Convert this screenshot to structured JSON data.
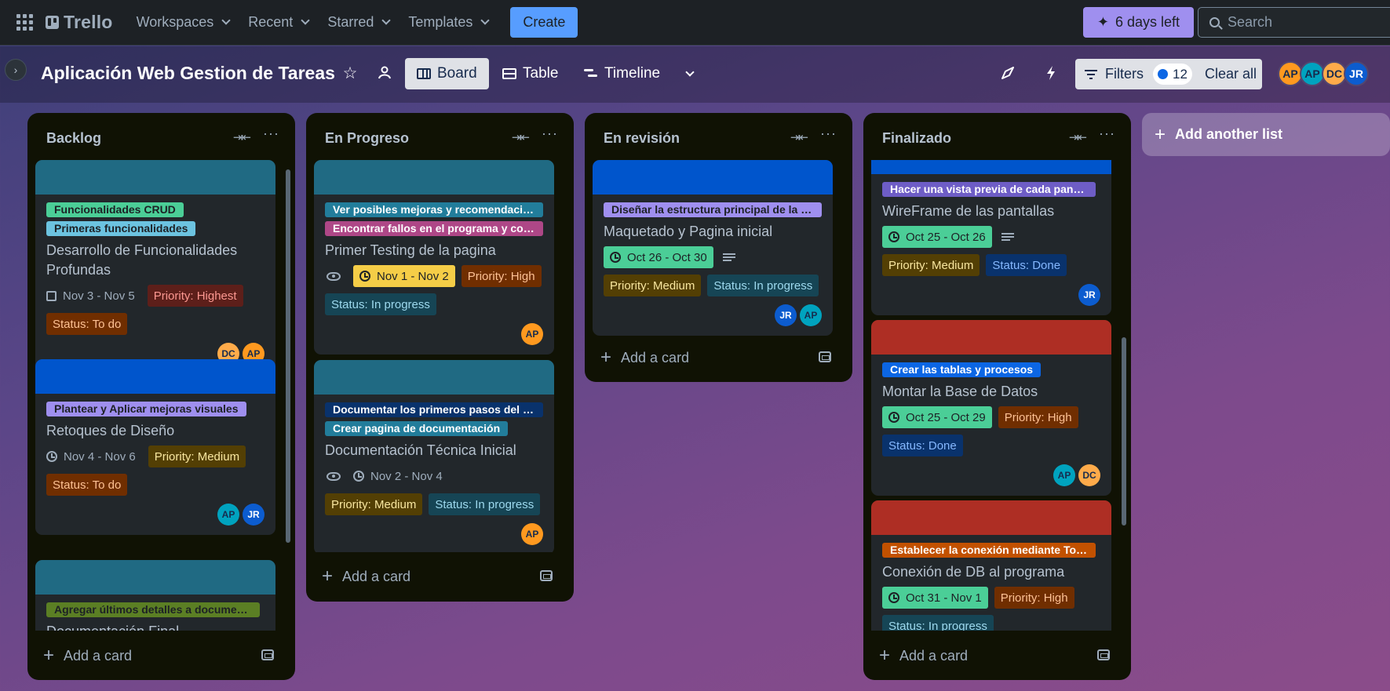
{
  "topbar": {
    "logo": "Trello",
    "nav": [
      {
        "label": "Workspaces"
      },
      {
        "label": "Recent"
      },
      {
        "label": "Starred"
      },
      {
        "label": "Templates"
      }
    ],
    "create_label": "Create",
    "trial_label": "6 days left",
    "search_placeholder": "Search",
    "colors": {
      "create": "#579dff",
      "trial": "#9f8fef"
    }
  },
  "board": {
    "title": "Aplicación Web Gestion de Tareas",
    "views": {
      "board": "Board",
      "table": "Table",
      "timeline": "Timeline"
    },
    "filters_label": "Filters",
    "filters_count": "12",
    "clear_all": "Clear all",
    "members": [
      "AP",
      "AP",
      "DC",
      "JR"
    ],
    "add_list": "Add another list",
    "add_card": "Add a card"
  },
  "lists": [
    {
      "title": "Backlog",
      "cards": [
        {
          "labels": [
            "Funcionalidades CRUD",
            "Primeras funcionalidades"
          ],
          "title": "Desarrollo de Funcionalidades Profundas",
          "date": "Nov 3 - Nov 5",
          "priority": "Priority: Highest",
          "status": "Status: To do",
          "members": [
            "DC",
            "AP"
          ]
        },
        {
          "labels": [
            "Plantear y Aplicar mejoras visuales"
          ],
          "title": "Retoques de Diseño",
          "date": "Nov 4 - Nov 6",
          "priority": "Priority: Medium",
          "status": "Status: To do",
          "members": [
            "AP",
            "JR"
          ]
        },
        {
          "labels": [
            "Agregar últimos detalles a documentación"
          ],
          "title": "Documentación Final"
        }
      ]
    },
    {
      "title": "En Progreso",
      "cards": [
        {
          "labels": [
            "Ver posibles mejoras y recomendaciones",
            "Encontrar fallos en el programa y corregirlos"
          ],
          "title": "Primer Testing de la pagina",
          "date": "Nov 1 - Nov 2",
          "priority": "Priority: High",
          "status": "Status: In progress",
          "members": [
            "AP"
          ]
        },
        {
          "labels": [
            "Documentar los primeros pasos del proyecto",
            "Crear pagina de documentación"
          ],
          "title": "Documentación Técnica Inicial",
          "date": "Nov 2 - Nov 4",
          "priority": "Priority: Medium",
          "status": "Status: In progress",
          "members": [
            "AP"
          ]
        }
      ]
    },
    {
      "title": "En revisión",
      "cards": [
        {
          "labels": [
            "Diseñar la estructura principal de la pagina"
          ],
          "title": "Maquetado y Pagina inicial",
          "date": "Oct 26 - Oct 30",
          "priority": "Priority: Medium",
          "status": "Status: In progress",
          "members": [
            "JR",
            "AP"
          ]
        }
      ]
    },
    {
      "title": "Finalizado",
      "cards": [
        {
          "labels": [
            "Hacer una vista previa de cada pantalla"
          ],
          "title": "WireFrame de las pantallas",
          "date": "Oct 25 - Oct 26",
          "priority": "Priority: Medium",
          "status": "Status: Done",
          "members": [
            "JR"
          ]
        },
        {
          "labels": [
            "Crear las tablas y procesos"
          ],
          "title": "Montar la Base de Datos",
          "date": "Oct 25 - Oct 29",
          "priority": "Priority: High",
          "status": "Status: Done",
          "members": [
            "AP",
            "DC"
          ]
        },
        {
          "labels": [
            "Establecer la conexión mediante Tokens"
          ],
          "title": "Conexión de DB al programa",
          "date": "Oct 31 - Nov 1",
          "priority": "Priority: High",
          "status": "Status: In progress"
        }
      ]
    }
  ],
  "colors": {
    "cover_teal": "#206a83",
    "cover_blue": "#0055cc",
    "cover_red": "#ae2e24",
    "label_green": "#4bce97",
    "label_sky": "#6cc3e0",
    "label_purple": "#9f8fef",
    "label_teal": "#227d9b",
    "label_pink": "#ae4787",
    "label_navy": "#09326c",
    "label_lime": "#5b7f24",
    "label_orange": "#c25100",
    "label_blue": "#0c66e4",
    "label_deep_purple": "#6e5dc6"
  }
}
